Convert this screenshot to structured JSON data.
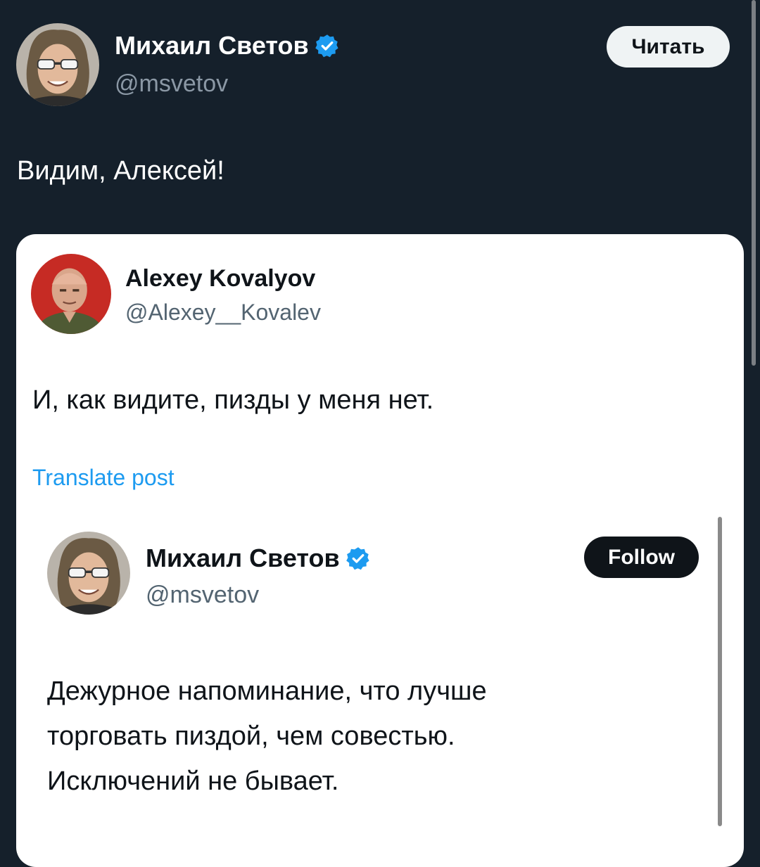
{
  "main_post": {
    "author_name": "Михаил Светов",
    "author_handle": "@msvetov",
    "follow_label": "Читать",
    "text": "Видим, Алексей!"
  },
  "quoted_post": {
    "author_name": "Alexey Kovalyov",
    "author_handle": "@Alexey__Kovalev",
    "text": "И, как видите, пизды у меня нет.",
    "translate_label": "Translate post"
  },
  "embedded_post": {
    "author_name": "Михаил Светов",
    "author_handle": "@msvetov",
    "follow_label": "Follow",
    "lines": [
      "Дежурное напоминание, что лучше",
      "торговать пиздой, чем совестью.",
      "Исключений не бывает."
    ]
  },
  "colors": {
    "background": "#15202b",
    "verified_badge": "#1d9bf0",
    "link": "#1d9bf0"
  },
  "icons": [
    "avatar-photo",
    "verified-badge-icon"
  ]
}
